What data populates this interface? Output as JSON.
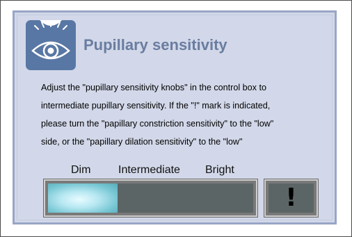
{
  "panel": {
    "title": "Pupillary sensitivity",
    "icon": "eye-with-light-icon",
    "description": [
      "Adjust the \"pupillary sensitivity knobs\" in the control box to",
      "intermediate pupillary sensitivity.  If the \"!\" mark is indicated,",
      "please turn the \"papillary constriction sensitivity\" to the \"low\"",
      "side, or the \"papillary dilation sensitivity\" to the \"low\""
    ]
  },
  "sensitivity_scale": {
    "labels": {
      "dim": "Dim",
      "intermediate": "Intermediate",
      "bright": "Bright"
    },
    "level_fraction": 0.34
  },
  "alert": {
    "mark": "!",
    "icon": "exclamation-icon"
  },
  "colors": {
    "panel_bg": "#d2d8e9",
    "title": "#6a7da0",
    "icon_bg": "#5977a4",
    "indicator_fill": "#b8e8f2",
    "indicator_track": "#5c6565"
  }
}
